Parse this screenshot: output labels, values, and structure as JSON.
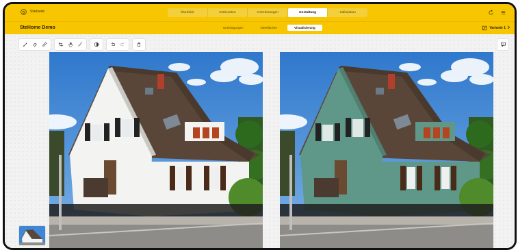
{
  "app": {
    "home_label": "Startseite",
    "project_name": "SteHome Demo",
    "variant_label": "Variante 1"
  },
  "main_tabs": [
    {
      "label": "Überblick",
      "active": false
    },
    {
      "label": "Vorbereiten",
      "active": false
    },
    {
      "label": "Anforderungen",
      "active": false
    },
    {
      "label": "Gestaltung",
      "active": true
    },
    {
      "label": "Kalkulation",
      "active": false
    }
  ],
  "sub_tabs": [
    {
      "label": "Unterlagungen",
      "active": false
    },
    {
      "label": "Oberflächen",
      "active": false
    },
    {
      "label": "Visualisierung",
      "active": true
    }
  ],
  "toolbar": {
    "groups": [
      [
        "brush-icon",
        "eraser-icon",
        "pen-icon"
      ],
      [
        "crop-icon",
        "hand-icon",
        "wand-icon"
      ],
      [
        "contrast-icon"
      ],
      [
        "undo-icon",
        "redo-icon"
      ],
      [
        "trash-icon"
      ]
    ]
  },
  "colors": {
    "accent": "#f7c600",
    "original_facade": "#f3f3f1",
    "variant_facade": "#5f9889",
    "roof": "#5a4638",
    "sky": "#3f86d6"
  }
}
